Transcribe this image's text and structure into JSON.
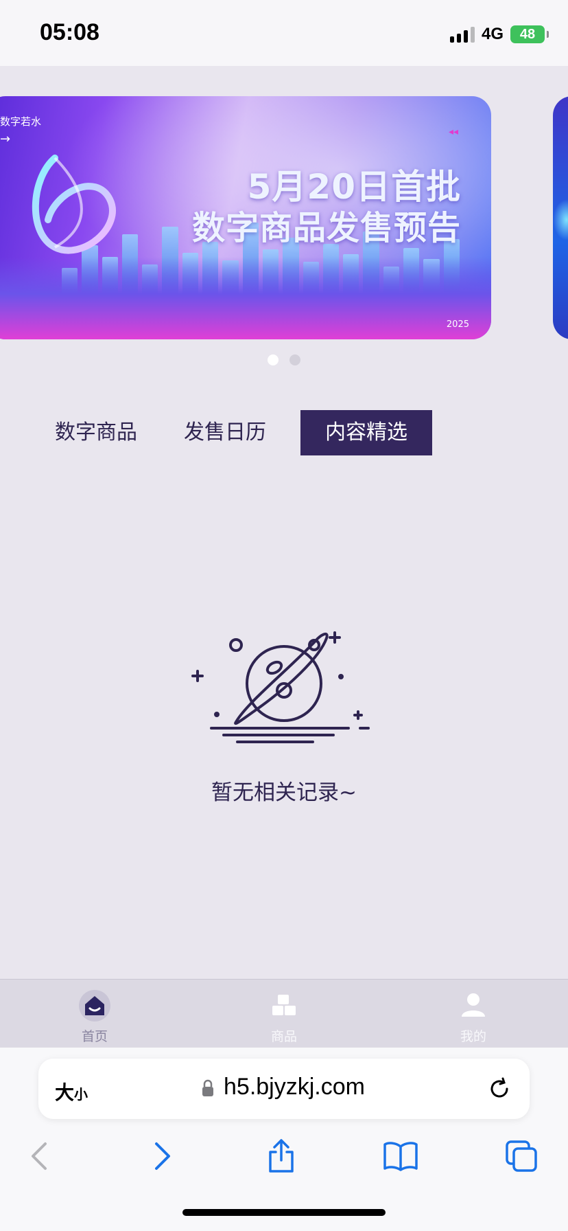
{
  "status": {
    "time": "05:08",
    "network": "4G",
    "battery": "48"
  },
  "banner": {
    "brand": "数字若水",
    "title_line1": "5月20日首批",
    "title_line2": "数字商品发售预告",
    "year": "2025",
    "slides_total": 2,
    "active_slide": 1
  },
  "tabs": [
    {
      "label": "数字商品",
      "active": false
    },
    {
      "label": "发售日历",
      "active": false
    },
    {
      "label": "内容精选",
      "active": true
    }
  ],
  "empty_state": {
    "message": "暂无相关记录~",
    "icon": "planet-icon"
  },
  "app_nav": [
    {
      "label": "首页",
      "icon": "home-icon",
      "active": true
    },
    {
      "label": "商品",
      "icon": "products-icon",
      "active": false
    },
    {
      "label": "我的",
      "icon": "profile-icon",
      "active": false
    }
  ],
  "browser": {
    "text_size_label": "大",
    "text_size_small": "小",
    "url": "h5.bjyzkj.com",
    "toolbar_icons": [
      "back-icon",
      "forward-icon",
      "share-icon",
      "bookmarks-icon",
      "tabs-icon"
    ]
  },
  "colors": {
    "background": "#e9e6ee",
    "accent": "#34275e",
    "text": "#2e2450",
    "browser_blue": "#1a73e8"
  }
}
